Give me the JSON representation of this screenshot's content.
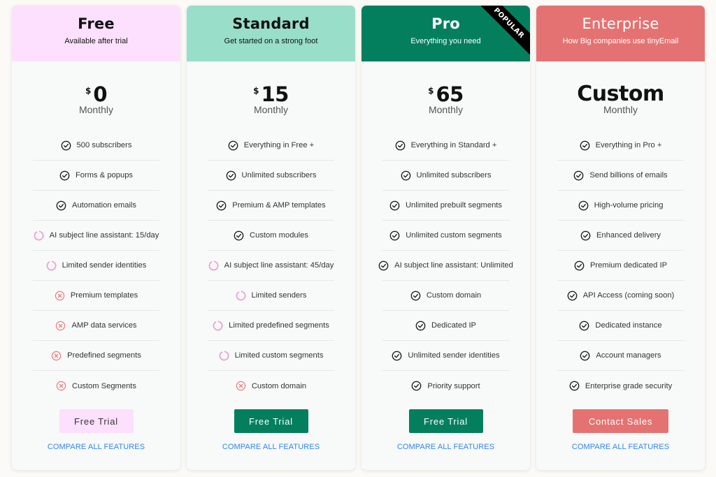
{
  "colors": {
    "free_header": "#fde0fd",
    "standard_header": "#98dec9",
    "pro_header": "#037f5e",
    "enterprise_header": "#e57272",
    "check": "#222222",
    "partial": "#f09ad2",
    "cross": "#f07a7a",
    "link": "#2f86f0"
  },
  "plans": [
    {
      "name": "Free",
      "tagline": "Available after trial",
      "currency": "$",
      "amount": "0",
      "period": "Monthly",
      "features": [
        {
          "status": "check",
          "icon": "check-circle-icon",
          "label": "500 subscribers"
        },
        {
          "status": "check",
          "icon": "check-circle-icon",
          "label": "Forms & popups"
        },
        {
          "status": "check",
          "icon": "check-circle-icon",
          "label": "Automation emails"
        },
        {
          "status": "partial",
          "icon": "partial-circle-icon",
          "label": "AI subject line assistant: 15/day"
        },
        {
          "status": "partial",
          "icon": "partial-circle-icon",
          "label": "Limited sender identities"
        },
        {
          "status": "cross",
          "icon": "x-circle-icon",
          "label": "Premium templates"
        },
        {
          "status": "cross",
          "icon": "x-circle-icon",
          "label": "AMP data services"
        },
        {
          "status": "cross",
          "icon": "x-circle-icon",
          "label": "Predefined segments"
        },
        {
          "status": "cross",
          "icon": "x-circle-icon",
          "label": "Custom Segments"
        }
      ],
      "cta": "Free Trial",
      "compare": "COMPARE ALL FEATURES"
    },
    {
      "name": "Standard",
      "tagline": "Get started on a strong foot",
      "currency": "$",
      "amount": "15",
      "period": "Monthly",
      "features": [
        {
          "status": "check",
          "icon": "check-circle-icon",
          "label": "Everything in Free +"
        },
        {
          "status": "check",
          "icon": "check-circle-icon",
          "label": "Unlimited subscribers"
        },
        {
          "status": "check",
          "icon": "check-circle-icon",
          "label": "Premium & AMP templates"
        },
        {
          "status": "check",
          "icon": "check-circle-icon",
          "label": "Custom modules"
        },
        {
          "status": "partial",
          "icon": "partial-circle-icon",
          "label": "AI subject line assistant: 45/day"
        },
        {
          "status": "partial",
          "icon": "partial-circle-icon",
          "label": "Limited senders"
        },
        {
          "status": "partial",
          "icon": "partial-circle-icon",
          "label": "Limited predefined segments"
        },
        {
          "status": "partial",
          "icon": "partial-circle-icon",
          "label": "Limited custom segments"
        },
        {
          "status": "cross",
          "icon": "x-circle-icon",
          "label": "Custom domain"
        }
      ],
      "cta": "Free Trial",
      "compare": "COMPARE ALL FEATURES"
    },
    {
      "name": "Pro",
      "tagline": "Everything you need",
      "badge": "POPULAR",
      "currency": "$",
      "amount": "65",
      "period": "Monthly",
      "features": [
        {
          "status": "check",
          "icon": "check-circle-icon",
          "label": "Everything in Standard +"
        },
        {
          "status": "check",
          "icon": "check-circle-icon",
          "label": "Unlimited subscribers"
        },
        {
          "status": "check",
          "icon": "check-circle-icon",
          "label": "Unlimited prebuilt segments"
        },
        {
          "status": "check",
          "icon": "check-circle-icon",
          "label": "Unlimited custom segments"
        },
        {
          "status": "check",
          "icon": "check-circle-icon",
          "label": "AI subject line assistant: Unlimited"
        },
        {
          "status": "check",
          "icon": "check-circle-icon",
          "label": "Custom domain"
        },
        {
          "status": "check",
          "icon": "check-circle-icon",
          "label": "Dedicated IP"
        },
        {
          "status": "check",
          "icon": "check-circle-icon",
          "label": "Unlimited sender identities"
        },
        {
          "status": "check",
          "icon": "check-circle-icon",
          "label": "Priority support"
        }
      ],
      "cta": "Free Trial",
      "compare": "COMPARE ALL FEATURES"
    },
    {
      "name": "Enterprise",
      "tagline": "How Big companies use tinyEmail",
      "currency": "",
      "amount": "Custom",
      "period": "Monthly",
      "features": [
        {
          "status": "check",
          "icon": "check-circle-icon",
          "label": "Everything in Pro +"
        },
        {
          "status": "check",
          "icon": "check-circle-icon",
          "label": "Send billions of emails"
        },
        {
          "status": "check",
          "icon": "check-circle-icon",
          "label": "High-volume pricing"
        },
        {
          "status": "check",
          "icon": "check-circle-icon",
          "label": "Enhanced delivery"
        },
        {
          "status": "check",
          "icon": "check-circle-icon",
          "label": "Premium dedicated IP"
        },
        {
          "status": "check",
          "icon": "check-circle-icon",
          "label": "API Access (coming soon)"
        },
        {
          "status": "check",
          "icon": "check-circle-icon",
          "label": "Dedicated instance"
        },
        {
          "status": "check",
          "icon": "check-circle-icon",
          "label": "Account managers"
        },
        {
          "status": "check",
          "icon": "check-circle-icon",
          "label": "Enterprise grade security"
        }
      ],
      "cta": "Contact Sales",
      "compare": "COMPARE ALL FEATURES"
    }
  ]
}
